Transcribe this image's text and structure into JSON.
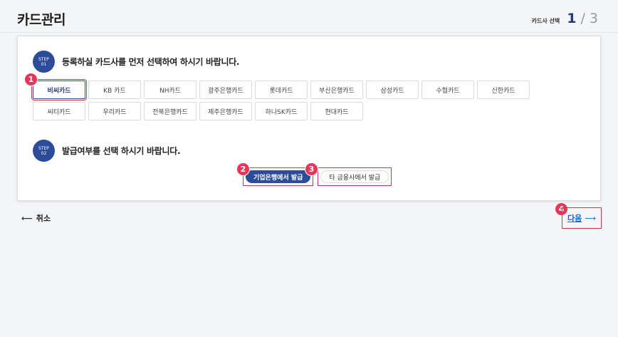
{
  "header": {
    "title": "카드관리",
    "step_label": "카드사 선택",
    "step_current": "1",
    "step_separator": "/",
    "step_total": "3"
  },
  "step1": {
    "badge_top": "STEP",
    "badge_num": "01",
    "instruction": "등록하실 카드사를 먼저 선택하여 하시기 바랍니다."
  },
  "cards": [
    {
      "label": "비씨카드",
      "selected": true
    },
    {
      "label": "KB 카드",
      "selected": false
    },
    {
      "label": "NH카드",
      "selected": false
    },
    {
      "label": "광주은행카드",
      "selected": false
    },
    {
      "label": "롯데카드",
      "selected": false
    },
    {
      "label": "부산은행카드",
      "selected": false
    },
    {
      "label": "삼성카드",
      "selected": false
    },
    {
      "label": "수협카드",
      "selected": false
    },
    {
      "label": "신한카드",
      "selected": false
    },
    {
      "label": "씨티카드",
      "selected": false
    },
    {
      "label": "우리카드",
      "selected": false
    },
    {
      "label": "전북은행카드",
      "selected": false
    },
    {
      "label": "제주은행카드",
      "selected": false
    },
    {
      "label": "하나SK카드",
      "selected": false
    },
    {
      "label": "현대카드",
      "selected": false
    }
  ],
  "step2": {
    "badge_top": "STEP",
    "badge_num": "02",
    "instruction": "발급여부를 선택 하시기 바랍니다.",
    "option_ibk": "기업은행에서 발급",
    "option_other": "타 금융사에서 발급"
  },
  "markers": {
    "m1": "1",
    "m2": "2",
    "m3": "3",
    "m4": "4"
  },
  "footer": {
    "cancel_label": "취소",
    "next_label": "다음"
  },
  "colors": {
    "primary": "#2c4b98",
    "marker": "#e5375a",
    "link": "#1a66d1"
  }
}
